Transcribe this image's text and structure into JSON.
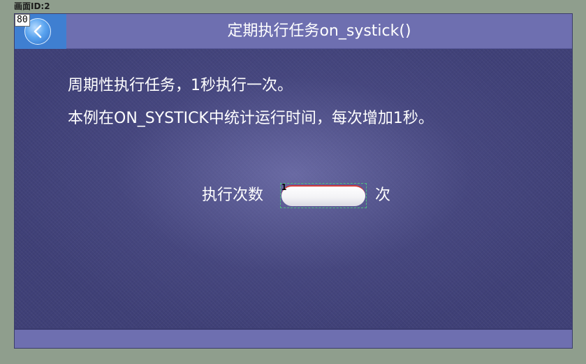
{
  "editor": {
    "screen_id_label": "画面ID:2"
  },
  "header": {
    "title": "定期执行任务on_systick()",
    "back_button": {
      "icon": "chevron-left-icon",
      "id_badge": "80"
    }
  },
  "main": {
    "description_line_1": "周期性执行任务，1秒执行一次。",
    "description_line_2": "本例在ON_SYSTICK中统计运行时间，每次增加1秒。",
    "counter": {
      "label": "执行次数",
      "value": "1",
      "unit": "次"
    }
  },
  "colors": {
    "header_bar": "#6e6fb0",
    "back_area": "#3f7fd1",
    "content_background": "#3f4077",
    "text": "#ffffff",
    "page_background": "#8f9e8d"
  }
}
